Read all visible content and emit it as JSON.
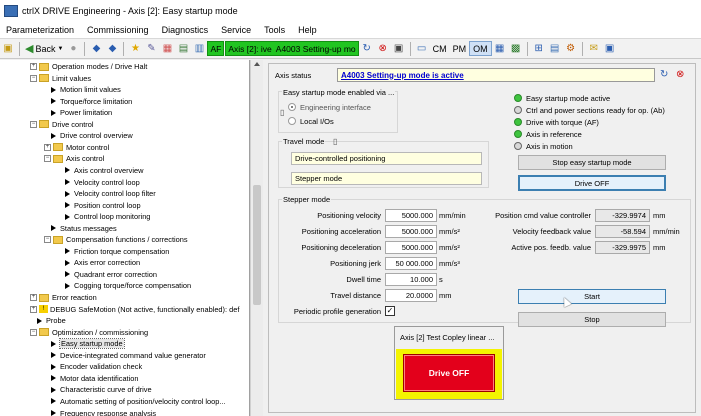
{
  "window": {
    "title": "ctrlX DRIVE Engineering - Axis [2]: Easy startup mode"
  },
  "menu": [
    "Parameterization",
    "Commissioning",
    "Diagnostics",
    "Service",
    "Tools",
    "Help"
  ],
  "toolbar": {
    "back_label": "Back",
    "af_label": "AF",
    "axis_label": "Axis [2]: ive",
    "status_label": "A4003 Setting-up mo",
    "cm_label": "CM",
    "pm_label": "PM",
    "om_label": "OM"
  },
  "tree": [
    {
      "label": "Operation modes / Drive Halt",
      "kind": "folder",
      "exp": "+",
      "indent": 0
    },
    {
      "label": "Limit values",
      "kind": "folder",
      "exp": "−",
      "indent": 0
    },
    {
      "label": "Motion limit values",
      "kind": "leaf",
      "indent": 1
    },
    {
      "label": "Torque/force limitation",
      "kind": "leaf",
      "indent": 1
    },
    {
      "label": "Power limitation",
      "kind": "leaf",
      "indent": 1
    },
    {
      "label": "Drive control",
      "kind": "folder",
      "exp": "−",
      "indent": 0
    },
    {
      "label": "Drive control overview",
      "kind": "leaf",
      "indent": 1
    },
    {
      "label": "Motor control",
      "kind": "folder",
      "exp": "+",
      "indent": 1
    },
    {
      "label": "Axis control",
      "kind": "folder",
      "exp": "−",
      "indent": 1
    },
    {
      "label": "Axis control overview",
      "kind": "leaf",
      "indent": 2
    },
    {
      "label": "Velocity control loop",
      "kind": "leaf",
      "indent": 2
    },
    {
      "label": "Velocity control loop filter",
      "kind": "leaf",
      "indent": 2
    },
    {
      "label": "Position control loop",
      "kind": "leaf",
      "indent": 2
    },
    {
      "label": "Control loop monitoring",
      "kind": "leaf",
      "indent": 2
    },
    {
      "label": "Status messages",
      "kind": "leaf",
      "indent": 1
    },
    {
      "label": "Compensation functions / corrections",
      "kind": "folder",
      "exp": "−",
      "indent": 1
    },
    {
      "label": "Friction torque compensation",
      "kind": "leaf",
      "indent": 2
    },
    {
      "label": "Axis error correction",
      "kind": "leaf",
      "indent": 2
    },
    {
      "label": "Quadrant error correction",
      "kind": "leaf",
      "indent": 2
    },
    {
      "label": "Cogging torque/force compensation",
      "kind": "leaf",
      "indent": 2
    },
    {
      "label": "Error reaction",
      "kind": "folder",
      "exp": "+",
      "indent": 0
    },
    {
      "label": "DEBUG SafeMotion (Not active, functionally enabled): def",
      "kind": "warn",
      "exp": "+",
      "indent": 0
    },
    {
      "label": "Probe",
      "kind": "leaf",
      "indent": 0
    },
    {
      "label": "Optimization / commissioning",
      "kind": "folder",
      "exp": "−",
      "indent": 0
    },
    {
      "label": "Easy startup mode",
      "kind": "leaf",
      "indent": 1,
      "selected": true
    },
    {
      "label": "Device-integrated command value generator",
      "kind": "leaf",
      "indent": 1
    },
    {
      "label": "Encoder validation check",
      "kind": "leaf",
      "indent": 1
    },
    {
      "label": "Motor data identification",
      "kind": "leaf",
      "indent": 1
    },
    {
      "label": "Characteristic curve of drive",
      "kind": "leaf",
      "indent": 1
    },
    {
      "label": "Automatic setting of position/velocity control loop...",
      "kind": "leaf",
      "indent": 1
    },
    {
      "label": "Frequency response analysis",
      "kind": "leaf",
      "indent": 1
    }
  ],
  "axis_status": {
    "label": "Axis status",
    "value": "A4003 Setting-up mode is active"
  },
  "enable": {
    "title": "Easy startup mode enabled via ...",
    "options": [
      "Engineering interface",
      "Local I/Os"
    ]
  },
  "leds": [
    {
      "label": "Easy startup mode active",
      "state": "green"
    },
    {
      "label": "Ctrl and power sections ready for op. (Ab)",
      "state": "gray"
    },
    {
      "label": "Drive with torque (AF)",
      "state": "green"
    },
    {
      "label": "Axis in reference",
      "state": "green"
    },
    {
      "label": "Axis in motion",
      "state": "gray"
    }
  ],
  "travel_mode": {
    "title": "Travel mode",
    "items": [
      "Drive-controlled positioning",
      "Stepper mode"
    ]
  },
  "buttons": {
    "stop_easy": "Stop easy startup mode",
    "drive_off": "Drive OFF",
    "start": "Start",
    "stop": "Stop"
  },
  "stepper": {
    "title": "Stepper mode",
    "params": [
      {
        "label": "Positioning velocity",
        "value": "5000.000",
        "unit": "mm/min"
      },
      {
        "label": "Positioning acceleration",
        "value": "5000.000",
        "unit": "mm/s²"
      },
      {
        "label": "Positioning deceleration",
        "value": "5000.000",
        "unit": "mm/s²"
      },
      {
        "label": "Positioning jerk",
        "value": "50 000.000",
        "unit": "mm/s³"
      },
      {
        "label": "Dwell time",
        "value": "10.000",
        "unit": "s"
      },
      {
        "label": "Travel distance",
        "value": "20.0000",
        "unit": "mm"
      }
    ],
    "periodic_label": "Periodic profile generation",
    "periodic_checked": "✓",
    "readouts": [
      {
        "label": "Position cmd value controller",
        "value": "-329.9974",
        "unit": "mm"
      },
      {
        "label": "Velocity feedback value",
        "value": "-58.594",
        "unit": "mm/min"
      },
      {
        "label": "Active pos. feedb. value",
        "value": "-329.9975",
        "unit": "mm"
      }
    ]
  },
  "popup": {
    "title": "Axis [2] Test Copley linear ...",
    "button": "Drive OFF"
  }
}
